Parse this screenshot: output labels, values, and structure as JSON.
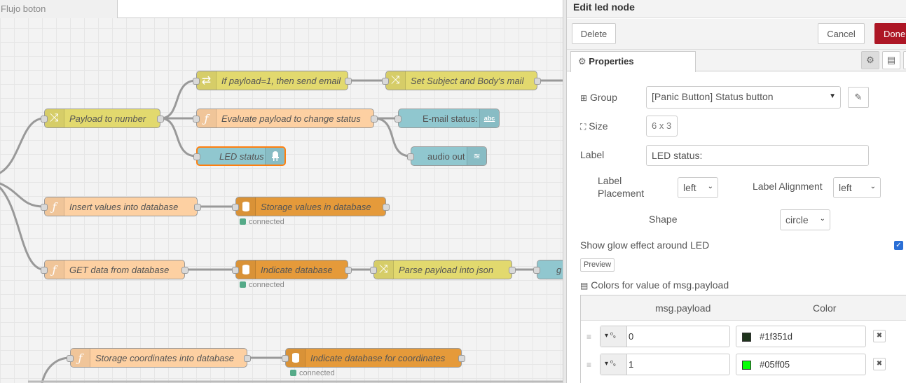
{
  "workspace": {
    "tab_label": "Flujo boton",
    "nodes": {
      "payload_to_number": "Payload to number",
      "if_payload": "If payload=1, then send email",
      "set_subject": "Set Subject and Body's mail",
      "evaluate_payload": "Evaluate payload to change status",
      "email_status": "E-mail status:",
      "led_status": "LED status",
      "audio_out": "audio out",
      "insert_values": "Insert values into database",
      "storage_values": "Storage values in database",
      "get_data": "GET data from database",
      "indicate_db": "Indicate database",
      "parse_payload": "Parse payload into json",
      "cut_node": "g",
      "storage_coords": "Storage coordinates into database",
      "indicate_db_coords": "Indicate database for coordinates"
    },
    "status_connected": "connected",
    "icons": {
      "change": "shuffle-icon",
      "switch": "switch-icon",
      "function": "function-icon",
      "database": "database-icon",
      "text": "abc-text-icon",
      "led": "led-icon",
      "audio": "audio-icon"
    }
  },
  "editor": {
    "title": "Edit led node",
    "delete_label": "Delete",
    "cancel_label": "Cancel",
    "done_label": "Done",
    "properties_tab": "Properties",
    "group_label": "Group",
    "group_value": "[Panic Button] Status button",
    "size_label": "Size",
    "size_value": "6 x 3",
    "label_label": "Label",
    "label_value": "LED status:",
    "label_placement_label_1": "Label",
    "label_placement_label_2": "Placement",
    "label_placement_value": "left",
    "label_alignment_label": "Label Alignment",
    "label_alignment_value": "left",
    "shape_label": "Shape",
    "shape_value": "circle",
    "glow_label": "Show glow effect around LED",
    "glow_checked": true,
    "preview_label": "Preview",
    "colors_heading": "Colors for value of msg.payload",
    "col_payload": "msg.payload",
    "col_color": "Color",
    "rows": [
      {
        "value": "0",
        "color_hex": "#1f351d",
        "type_glyph": "⁰₉"
      },
      {
        "value": "1",
        "color_hex": "#05ff05",
        "type_glyph": "⁰₉"
      }
    ]
  },
  "colors": {
    "done_button": "#ad1625",
    "change_node": "#e2d96e",
    "function_node": "#fdd0a2",
    "database_node": "#e59a3a",
    "ui_node": "#90c7cf",
    "selected_outline": "#ff7f0e"
  }
}
